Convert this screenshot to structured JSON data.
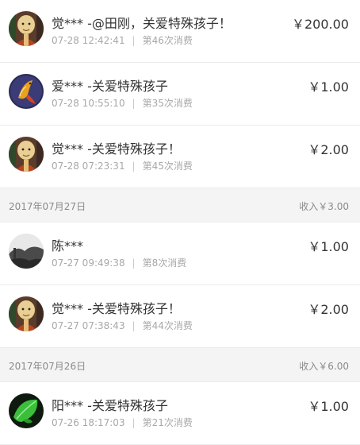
{
  "donations": [
    {
      "name": "觉***",
      "message": " -@田刚，关爱特殊孩子！",
      "time": "07-28 12:42:41",
      "count": "第46次消费",
      "amount": "￥200.00",
      "avatar": "monk-avatar-icon"
    },
    {
      "name": "爱***",
      "message": " -关爱特殊孩子",
      "time": "07-28 10:55:10",
      "count": "第35次消费",
      "amount": "￥1.00",
      "avatar": "koi-fish-avatar-icon"
    },
    {
      "name": "觉***",
      "message": " -关爱特殊孩子！",
      "time": "07-28 07:23:31",
      "count": "第45次消费",
      "amount": "￥2.00",
      "avatar": "monk-avatar-icon"
    }
  ],
  "groups": [
    {
      "date": "2017年07月27日",
      "income": "收入￥3.00",
      "rows": [
        {
          "name": "陈***",
          "message": "",
          "time": "07-27 09:49:38",
          "count": "第8次消费",
          "amount": "￥1.00",
          "avatar": "landscape-avatar-icon"
        },
        {
          "name": "觉***",
          "message": " -关爱特殊孩子！",
          "time": "07-27 07:38:43",
          "count": "第44次消费",
          "amount": "￥2.00",
          "avatar": "monk-avatar-icon"
        }
      ]
    },
    {
      "date": "2017年07月26日",
      "income": "收入￥6.00",
      "rows": [
        {
          "name": "阳***",
          "message": " -关爱特殊孩子",
          "time": "07-26 18:17:03",
          "count": "第21次消费",
          "amount": "￥1.00",
          "avatar": "green-leaf-avatar-icon"
        }
      ]
    }
  ],
  "separator": "|",
  "colors": {
    "text": "#333333",
    "meta": "#a8a8a8",
    "header_bg": "#f4f4f4",
    "divider": "#ececec"
  }
}
